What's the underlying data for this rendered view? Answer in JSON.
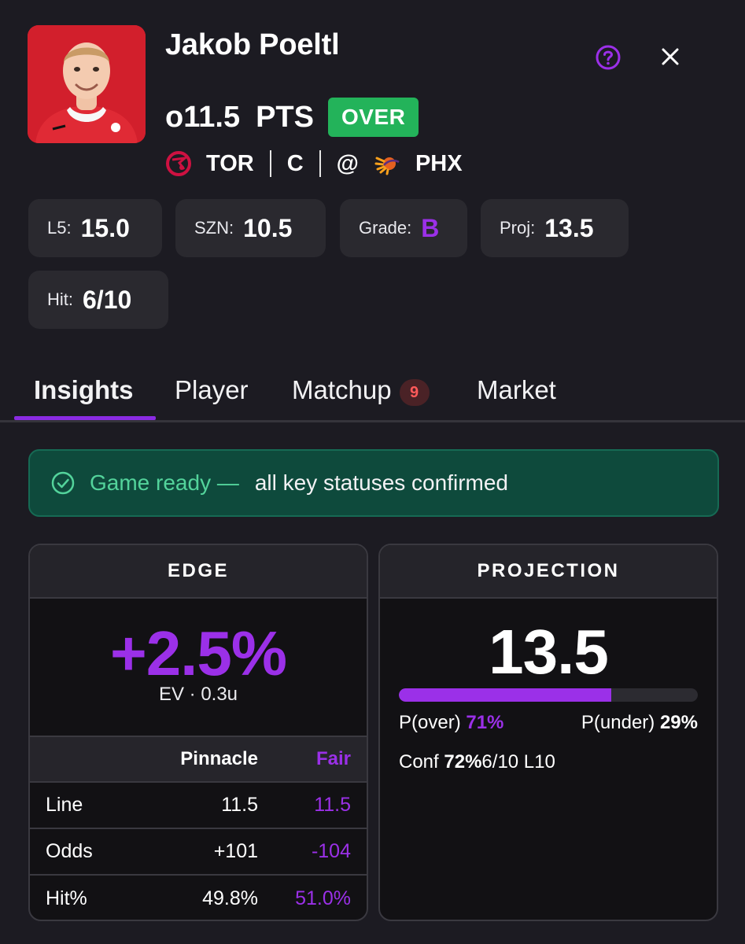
{
  "player": {
    "name": "Jakob Poeltl",
    "line": "o11.5",
    "stat": "PTS",
    "pick": "OVER"
  },
  "matchup": {
    "team": "TOR",
    "position": "C",
    "at": "@",
    "opponent": "PHX"
  },
  "icons": {
    "help": "help-circle-icon",
    "close": "close-icon",
    "team_logo": "raptors-logo-icon",
    "opponent_logo": "suns-logo-icon",
    "ready": "check-circle-icon"
  },
  "stats": {
    "l5_label": "L5:",
    "l5_value": "15.0",
    "szn_label": "SZN:",
    "szn_value": "10.5",
    "grade_label": "Grade:",
    "grade_value": "B",
    "proj_label": "Proj:",
    "proj_value": "13.5",
    "hit_label": "Hit:",
    "hit_value": "6/10"
  },
  "tabs": {
    "insights": "Insights",
    "player": "Player",
    "matchup": "Matchup",
    "matchup_badge": "9",
    "market": "Market"
  },
  "status": {
    "title": "Game ready —",
    "text": "all key statuses confirmed"
  },
  "edge": {
    "heading": "EDGE",
    "value": "+2.5%",
    "ev": "EV · 0.3u",
    "col_pinnacle": "Pinnacle",
    "col_fair": "Fair",
    "rows": [
      {
        "label": "Line",
        "pinnacle": "11.5",
        "fair": "11.5"
      },
      {
        "label": "Odds",
        "pinnacle": "+101",
        "fair": "-104"
      },
      {
        "label": "Hit%",
        "pinnacle": "49.8%",
        "fair": "51.0%"
      }
    ]
  },
  "projection": {
    "heading": "PROJECTION",
    "value": "13.5",
    "over_fraction": 0.71,
    "p_over_label": "P(over)",
    "p_over_value": "71%",
    "p_under_label": "P(under)",
    "p_under_value": "29%",
    "conf_label": "Conf",
    "conf_value": "72%",
    "hit_l10": "6/10 L10"
  },
  "colors": {
    "background": "#1c1b22",
    "accent_purple": "#9b30e8",
    "over_green": "#23b35a",
    "ready_bg": "#0e4a3c",
    "ready_text": "#53d39b",
    "badge_red": "#ff5a5a"
  }
}
